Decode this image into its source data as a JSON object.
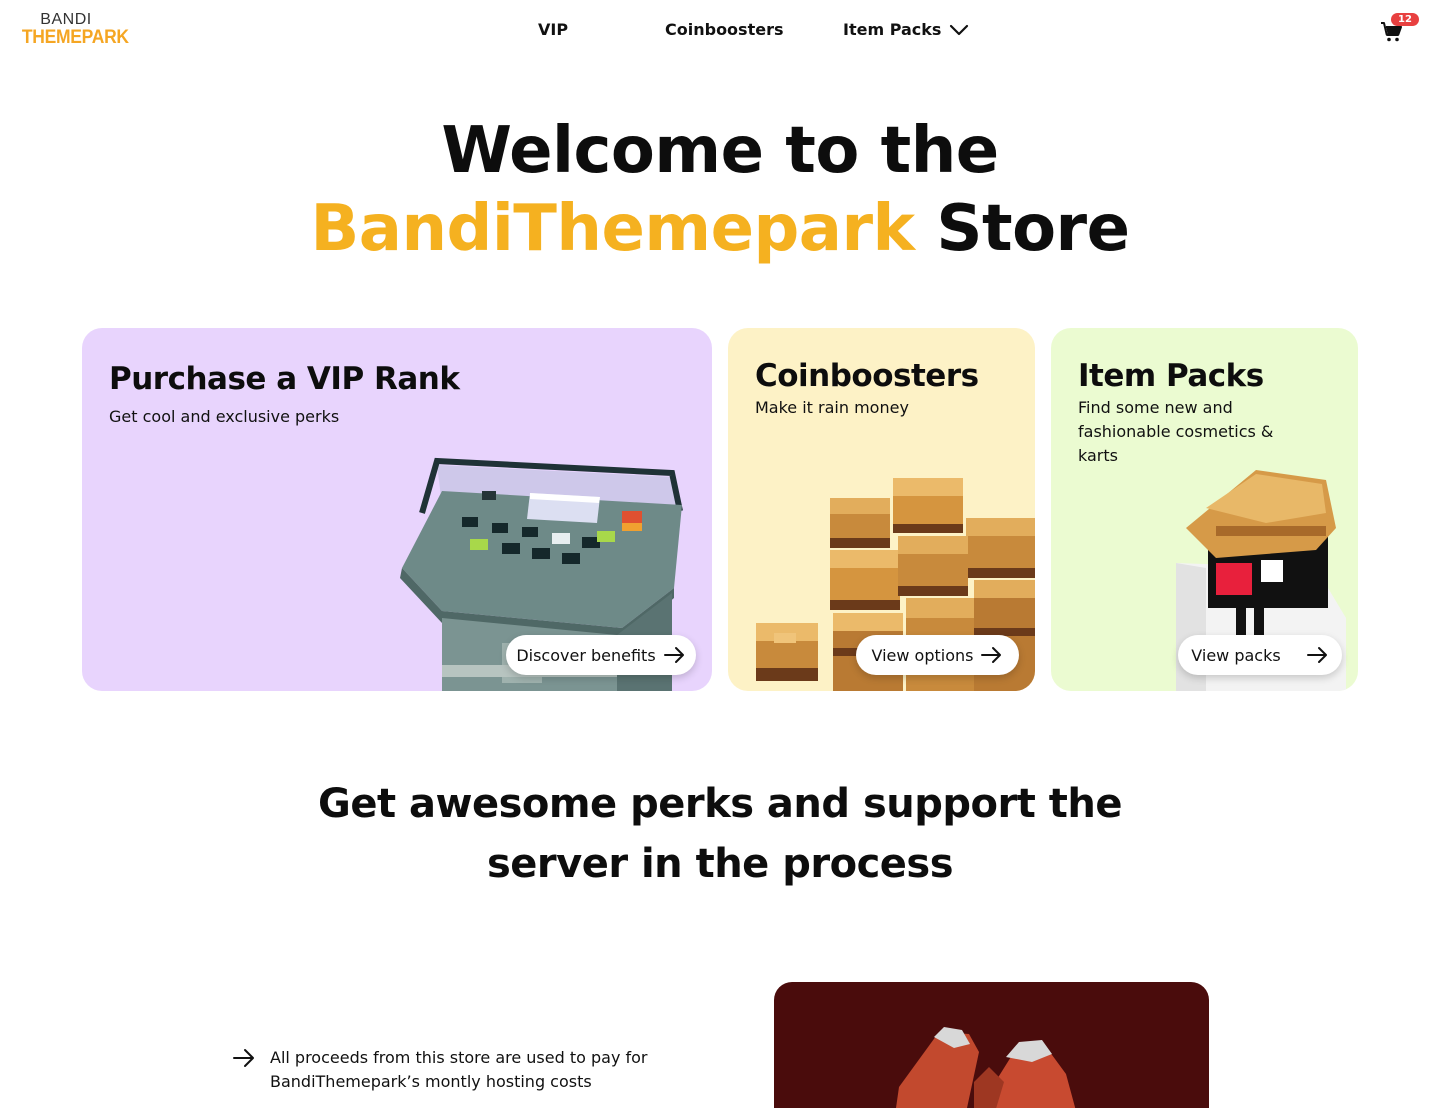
{
  "header": {
    "logo_top": "BANDI",
    "logo_bottom": "THEMEPARK",
    "nav": {
      "vip": "VIP",
      "coinboosters": "Coinboosters",
      "item_packs": "Item Packs"
    },
    "cart_count": "12"
  },
  "hero": {
    "line1": "Welcome to the",
    "line2_accent": "BandiThemepark",
    "line2_rest": "Store"
  },
  "cards": {
    "vip": {
      "title": "Purchase a VIP Rank",
      "subtitle": "Get cool and exclusive perks",
      "cta": "Discover benefits"
    },
    "coinboosters": {
      "title": "Coinboosters",
      "subtitle": "Make it rain money",
      "cta": "View options"
    },
    "item_packs": {
      "title": "Item Packs",
      "subtitle": "Find some new and fashionable cosmetics & karts",
      "cta": "View packs"
    }
  },
  "perks": {
    "title_line1": "Get awesome perks and support the",
    "title_line2": "server in the process",
    "items": [
      "All proceeds from this store are used to pay for BandiThemepark’s montly hosting costs"
    ]
  },
  "colors": {
    "accent": "#f5b120",
    "vip_card": "#e8d4fd",
    "coin_card": "#fdf2c6",
    "items_card": "#ebfbd1",
    "cart_badge": "#e84040",
    "red_panel": "#4a0c0c"
  },
  "icons": [
    "chevron-down-icon",
    "cart-icon",
    "arrow-right-icon"
  ]
}
